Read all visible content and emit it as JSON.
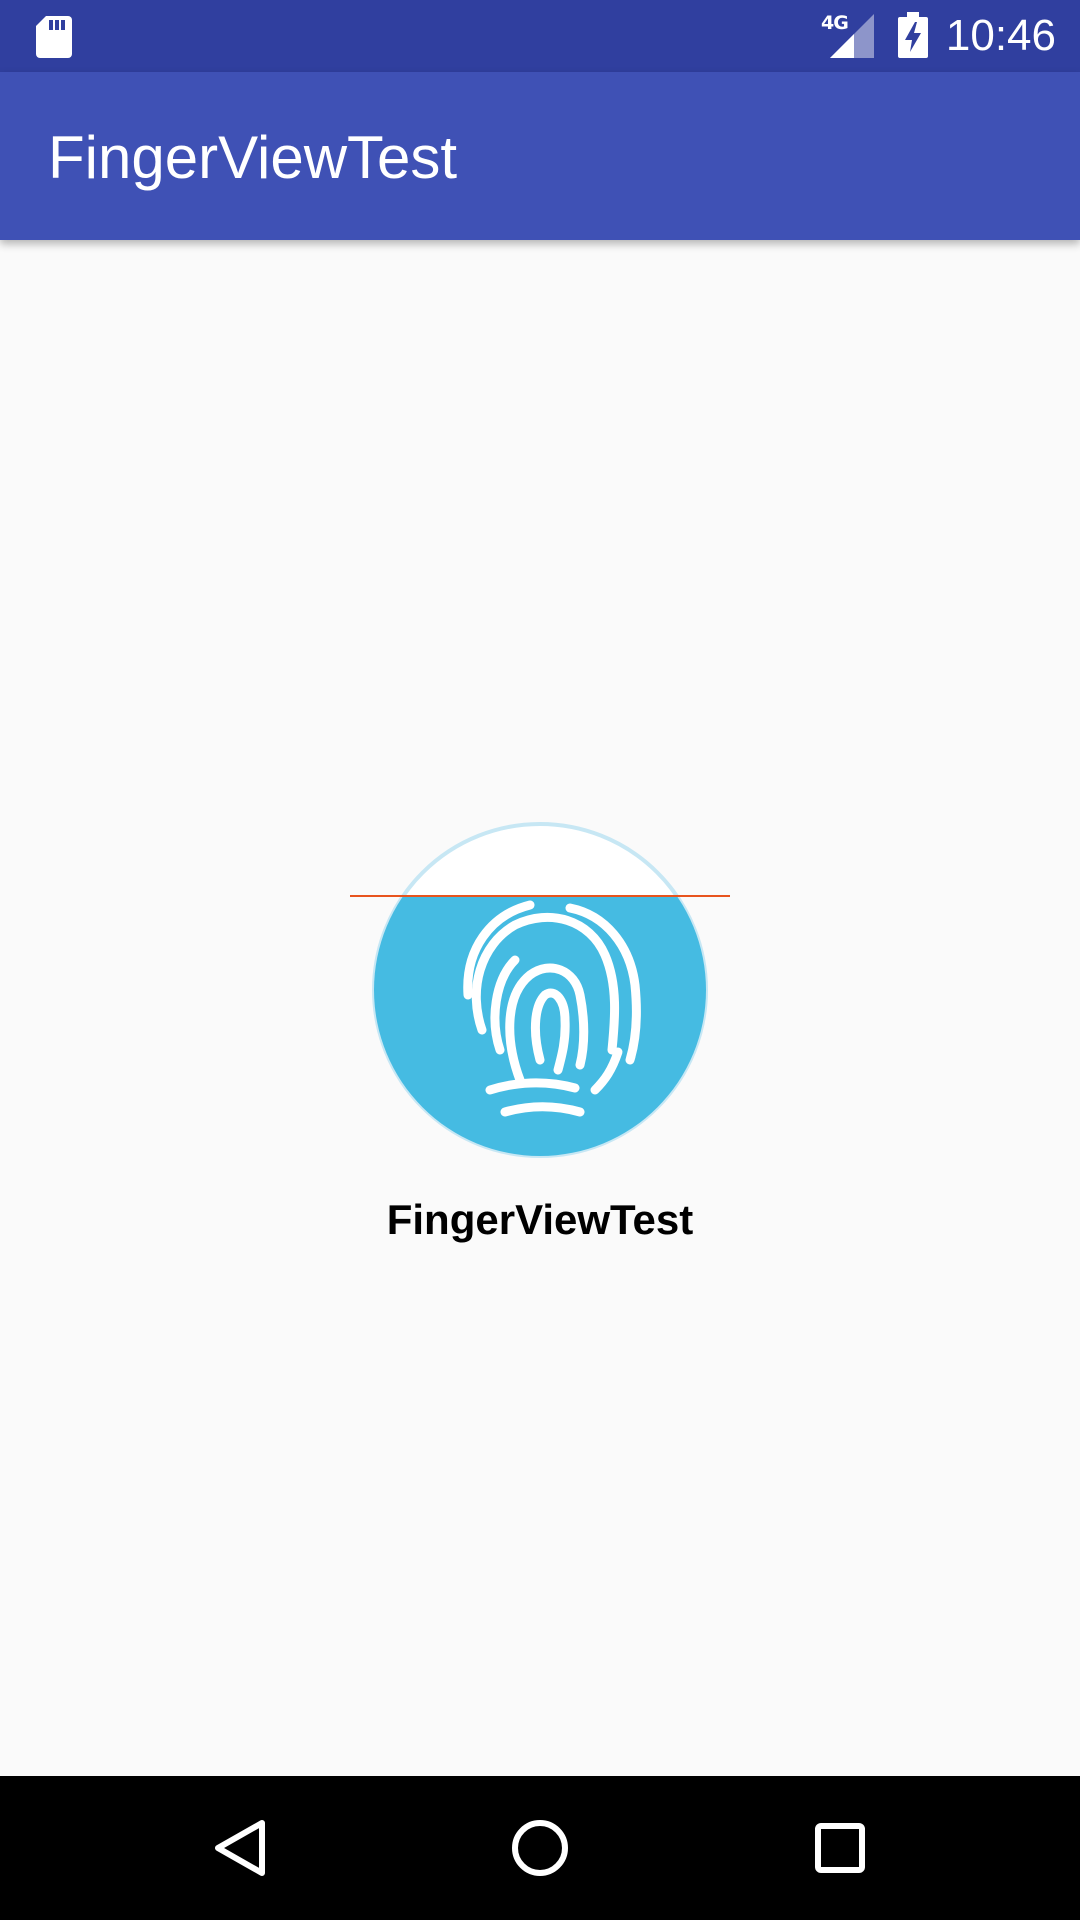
{
  "status_bar": {
    "time": "10:46",
    "network_type": "4G",
    "icons": [
      "sd-card-icon",
      "signal-icon",
      "battery-charging-icon"
    ],
    "background": "#303f9f"
  },
  "app_bar": {
    "title": "FingerViewTest",
    "background": "#3f51b5"
  },
  "main": {
    "fingerprint_view": {
      "icon": "fingerprint-icon",
      "fill_color": "#45bbe2",
      "scan_line_color": "#e8541e"
    },
    "caption": "FingerViewTest"
  },
  "nav_bar": {
    "buttons": [
      "back-icon",
      "home-icon",
      "recents-icon"
    ]
  }
}
